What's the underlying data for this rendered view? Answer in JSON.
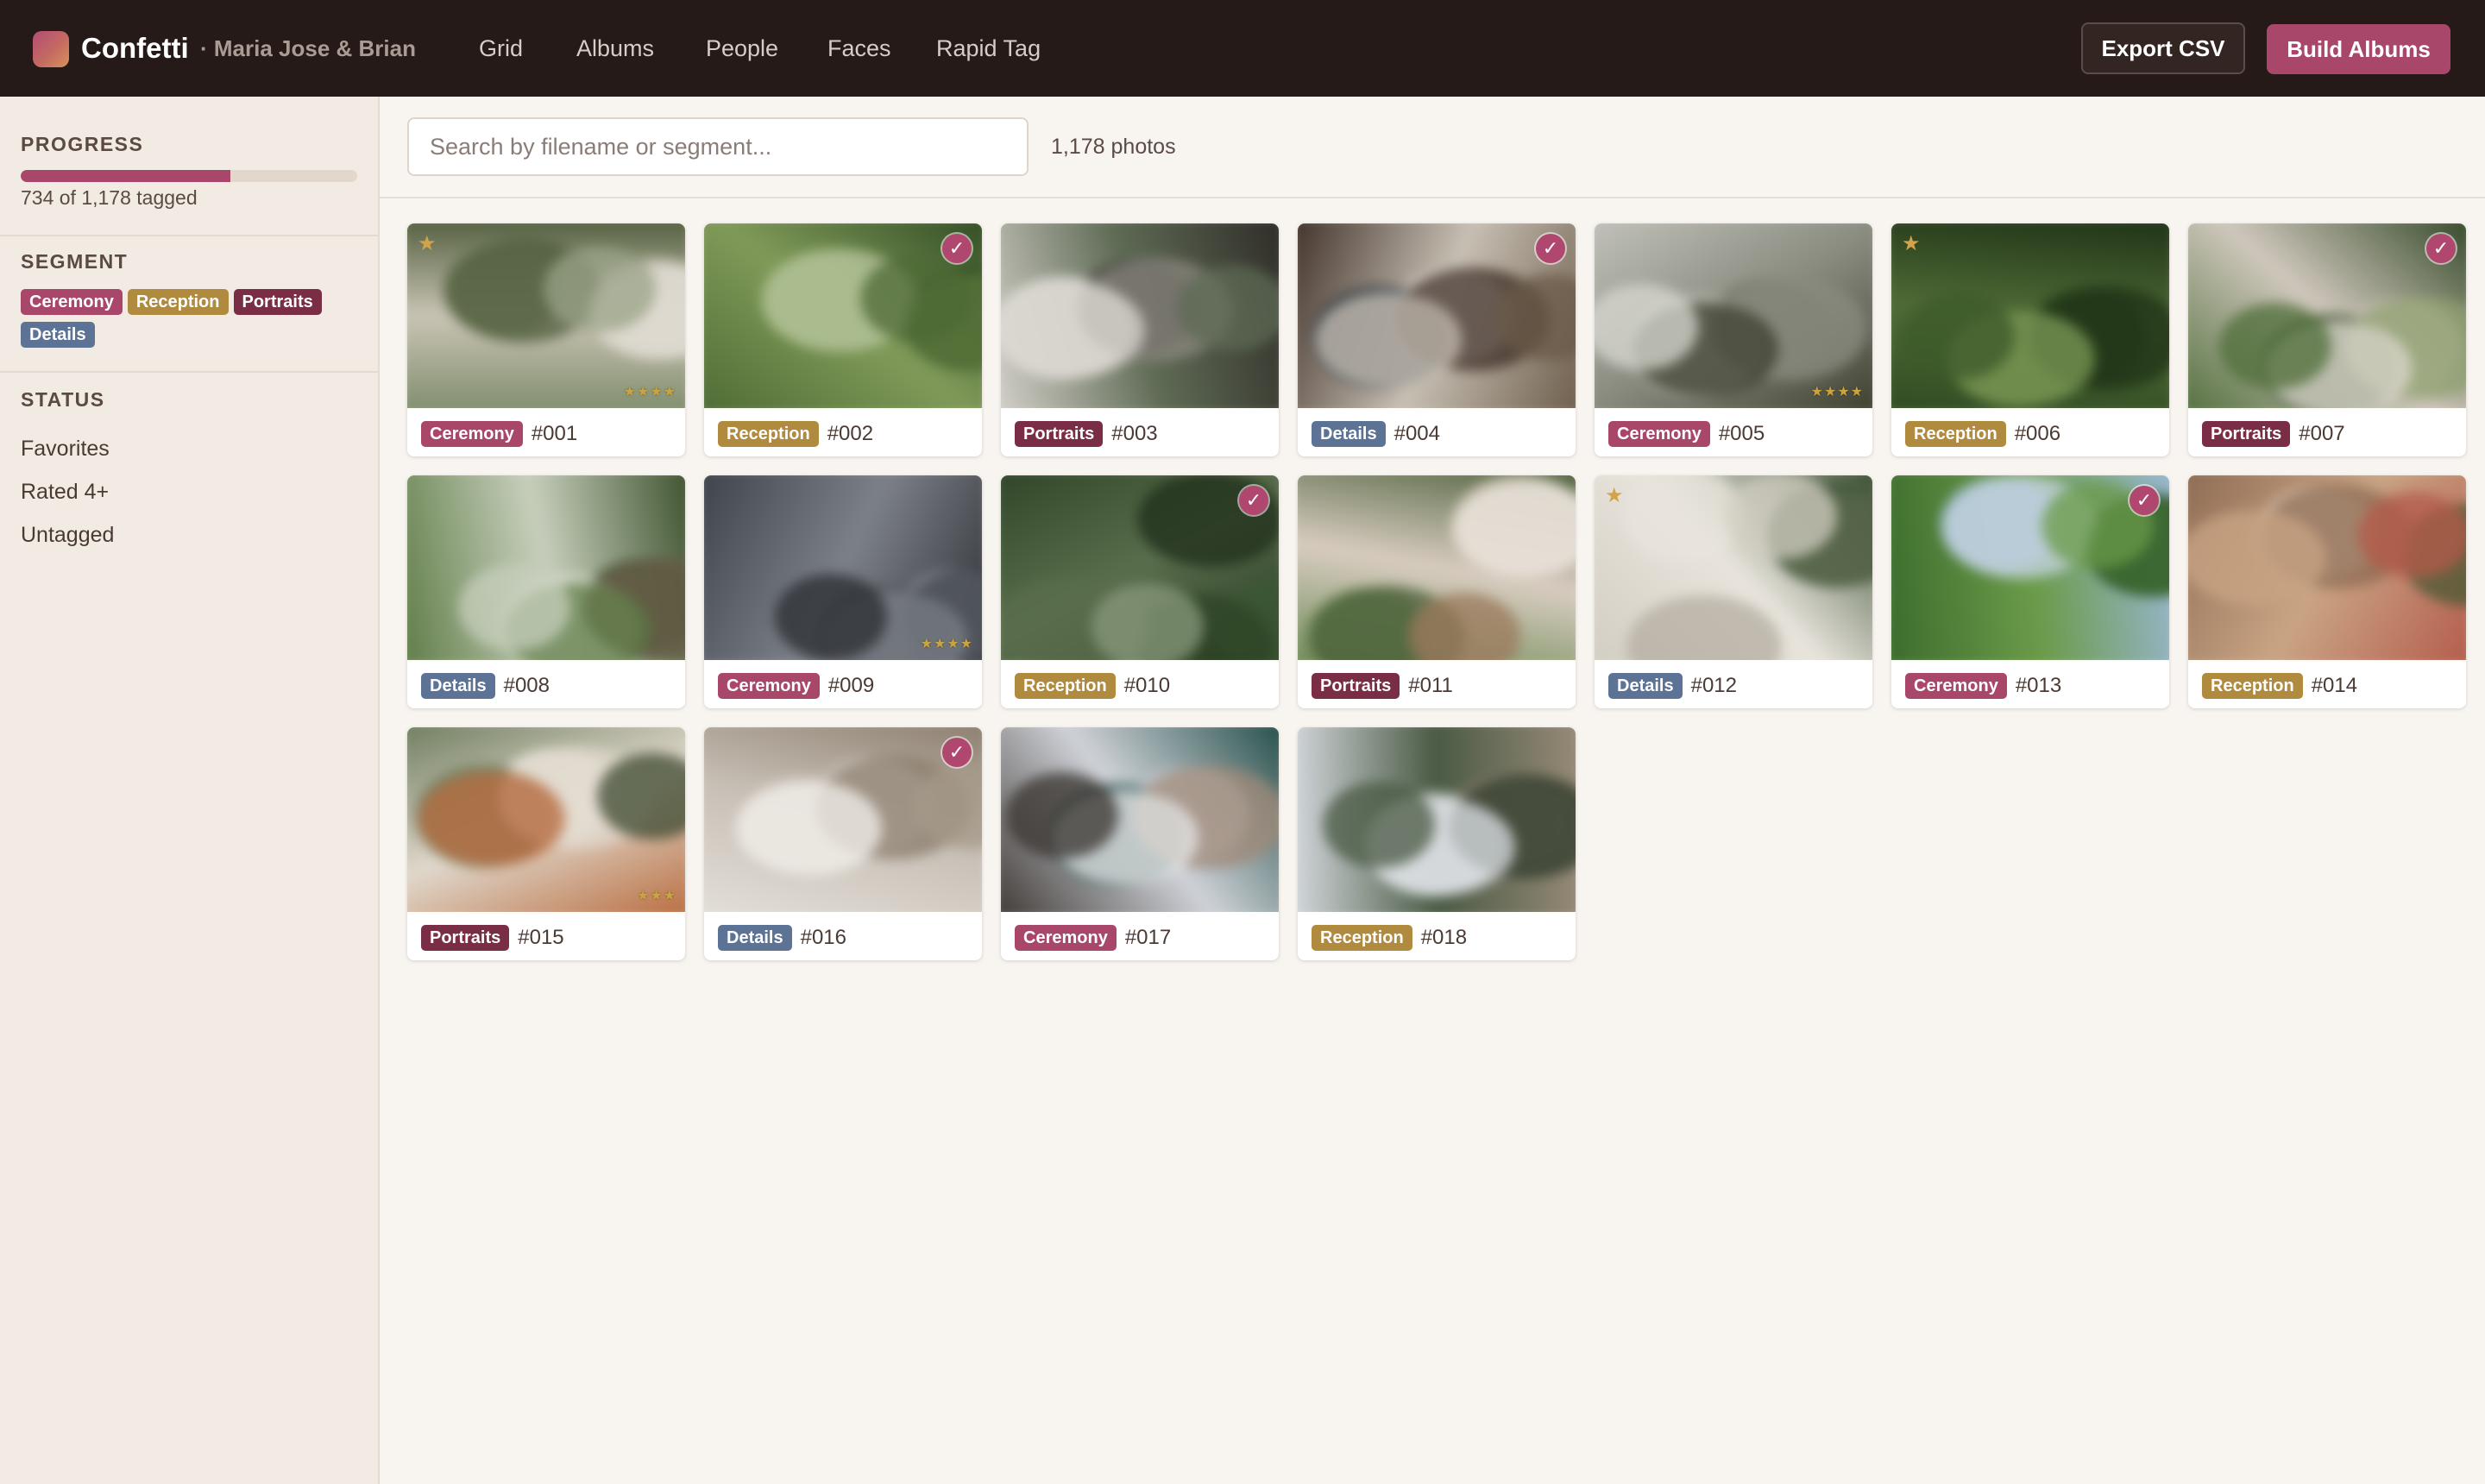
{
  "app": {
    "name": "Confetti",
    "project": "· Maria Jose & Brian"
  },
  "nav": [
    {
      "label": "Grid",
      "active": true
    },
    {
      "label": "Albums",
      "active": false
    },
    {
      "label": "People",
      "active": false
    },
    {
      "label": "Faces",
      "active": false
    },
    {
      "label": "Rapid Tag",
      "active": true
    }
  ],
  "actions": {
    "export": "Export CSV",
    "build": "Build Albums"
  },
  "sidebar": {
    "progress": {
      "heading": "PROGRESS",
      "tagged": 734,
      "total": 1178,
      "fraction": 0.623,
      "text": "734 of 1,178 tagged"
    },
    "segment": {
      "heading": "SEGMENT",
      "chips": [
        {
          "label": "Ceremony",
          "color": "#a8476a"
        },
        {
          "label": "Reception",
          "color": "#b08a3e"
        },
        {
          "label": "Portraits",
          "color": "#7a2e45"
        },
        {
          "label": "Details",
          "color": "#5d7395"
        }
      ]
    },
    "status": {
      "heading": "STATUS",
      "items": [
        "Favorites",
        "Rated 4+",
        "Untagged"
      ]
    }
  },
  "search": {
    "placeholder": "Search by filename or segment...",
    "value": ""
  },
  "photo_count": "1,178 photos",
  "segment_colors": {
    "Ceremony": "#a8476a",
    "Reception": "#b08a3e",
    "Portraits": "#7a2e45",
    "Details": "#5d7395"
  },
  "photos": [
    {
      "number": "#001",
      "segment": "Ceremony",
      "checked": false,
      "favorite": true,
      "rating": 4
    },
    {
      "number": "#002",
      "segment": "Reception",
      "checked": true,
      "favorite": false,
      "rating": 0
    },
    {
      "number": "#003",
      "segment": "Portraits",
      "checked": false,
      "favorite": false,
      "rating": 0
    },
    {
      "number": "#004",
      "segment": "Details",
      "checked": true,
      "favorite": false,
      "rating": 0
    },
    {
      "number": "#005",
      "segment": "Ceremony",
      "checked": false,
      "favorite": false,
      "rating": 4
    },
    {
      "number": "#006",
      "segment": "Reception",
      "checked": false,
      "favorite": true,
      "rating": 0
    },
    {
      "number": "#007",
      "segment": "Portraits",
      "checked": true,
      "favorite": false,
      "rating": 0
    },
    {
      "number": "#008",
      "segment": "Details",
      "checked": false,
      "favorite": false,
      "rating": 0
    },
    {
      "number": "#009",
      "segment": "Ceremony",
      "checked": false,
      "favorite": false,
      "rating": 4
    },
    {
      "number": "#010",
      "segment": "Reception",
      "checked": true,
      "favorite": false,
      "rating": 0
    },
    {
      "number": "#011",
      "segment": "Portraits",
      "checked": false,
      "favorite": false,
      "rating": 0
    },
    {
      "number": "#012",
      "segment": "Details",
      "checked": false,
      "favorite": true,
      "rating": 0
    },
    {
      "number": "#013",
      "segment": "Ceremony",
      "checked": true,
      "favorite": false,
      "rating": 0
    },
    {
      "number": "#014",
      "segment": "Reception",
      "checked": false,
      "favorite": false,
      "rating": 0
    },
    {
      "number": "#015",
      "segment": "Portraits",
      "checked": false,
      "favorite": false,
      "rating": 3
    },
    {
      "number": "#016",
      "segment": "Details",
      "checked": true,
      "favorite": false,
      "rating": 0
    },
    {
      "number": "#017",
      "segment": "Ceremony",
      "checked": false,
      "favorite": false,
      "rating": 0
    },
    {
      "number": "#018",
      "segment": "Reception",
      "checked": false,
      "favorite": false,
      "rating": 0
    }
  ]
}
